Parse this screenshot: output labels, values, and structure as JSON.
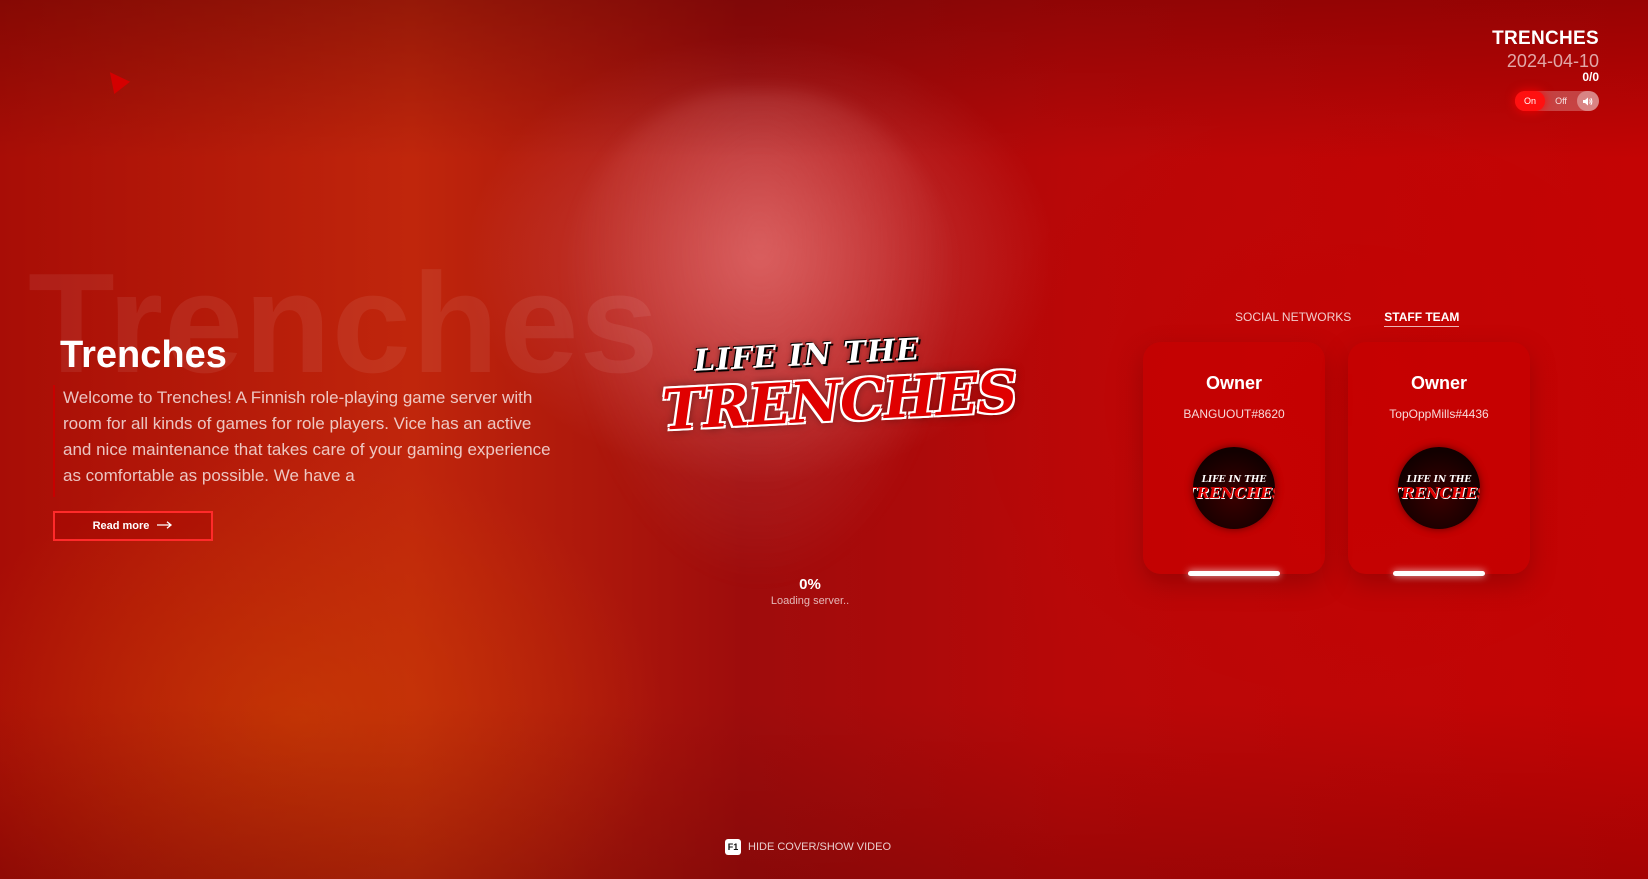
{
  "server": {
    "name": "TRENCHES",
    "date": "2024-04-10",
    "players": "0/0"
  },
  "music": {
    "on_label": "On",
    "off_label": "Off",
    "volume_icon": "speaker-icon",
    "state": "on"
  },
  "hero": {
    "background_word": "Trenches",
    "title": "Trenches",
    "description": "Welcome to Trenches! A Finnish role-playing game server with room for all kinds of games for role players. Vice has an active and nice maintenance that takes care of your gaming experience as comfortable as possible. We have a",
    "read_more_label": "Read more",
    "read_more_icon": "arrow-right-icon"
  },
  "logo": {
    "top_text": "LIFE IN THE",
    "main_text": "TRENCHES"
  },
  "loading": {
    "percent": "0%",
    "status": "Loading server.."
  },
  "tabs": [
    {
      "label": "SOCIAL NETWORKS",
      "active": false
    },
    {
      "label": "STAFF TEAM",
      "active": true
    }
  ],
  "staff": [
    {
      "role": "Owner",
      "handle": "BANGUOUT#8620"
    },
    {
      "role": "Owner",
      "handle": "TopOppMills#4436"
    }
  ],
  "footer": {
    "key": "F1",
    "hint": "HIDE COVER/SHOW VIDEO"
  },
  "colors": {
    "accent": "#ff1010",
    "background": "#b3100a"
  }
}
